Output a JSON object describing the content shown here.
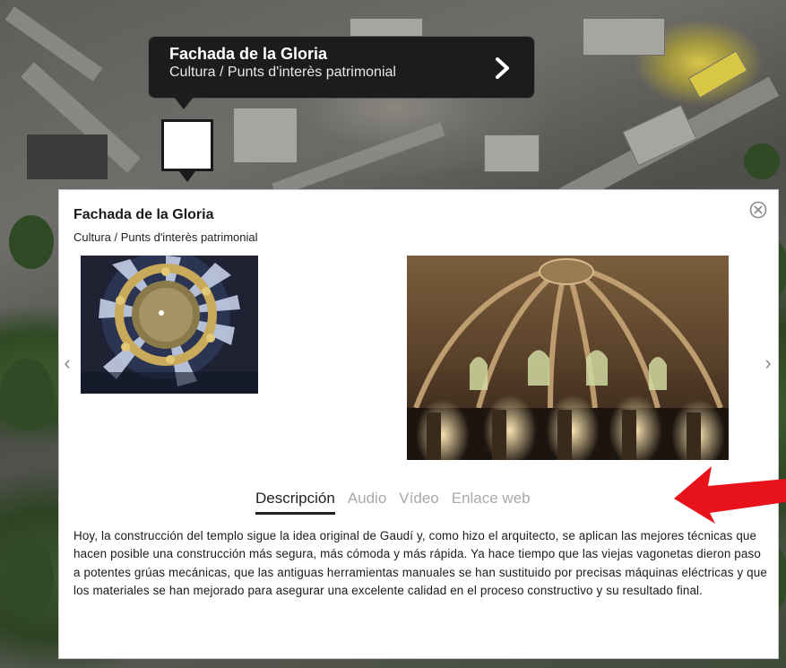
{
  "marker_popup": {
    "title": "Fachada de la Gloria",
    "subtitle": "Cultura / Punts d'interès patrimonial"
  },
  "info_window": {
    "title": "Fachada de la Gloria",
    "subtitle": "Cultura / Punts d'interès patrimonial",
    "prev_arrow": "‹",
    "next_arrow": "›",
    "tabs": [
      {
        "label": "Descripción",
        "active": true
      },
      {
        "label": "Audio",
        "active": false
      },
      {
        "label": "Vídeo",
        "active": false
      },
      {
        "label": "Enlace web",
        "active": false
      }
    ],
    "description": "Hoy, la construcción del templo sigue la idea original de Gaudí y, como hizo el arquitecto, se aplican las mejores técnicas que hacen posible una construcción más segura, más cómoda y más rápida. Ya hace tiempo que las viejas vagonetas dieron paso a potentes grúas mecánicas, que las antiguas herramientas manuales se han sustituido por precisas máquinas eléctricas y que los materiales se han mejorado para asegurar una excelente calidad en el proceso constructivo y su resultado final."
  },
  "icons": {
    "close": "close-circle-icon",
    "chevron": "chevron-right-icon",
    "annotation": "red-arrow-icon"
  },
  "colors": {
    "popup_bg": "#1c1c1c",
    "tab_active": "#222222",
    "tab_inactive": "#a9a9a9",
    "annotation_arrow": "#e8121a"
  }
}
